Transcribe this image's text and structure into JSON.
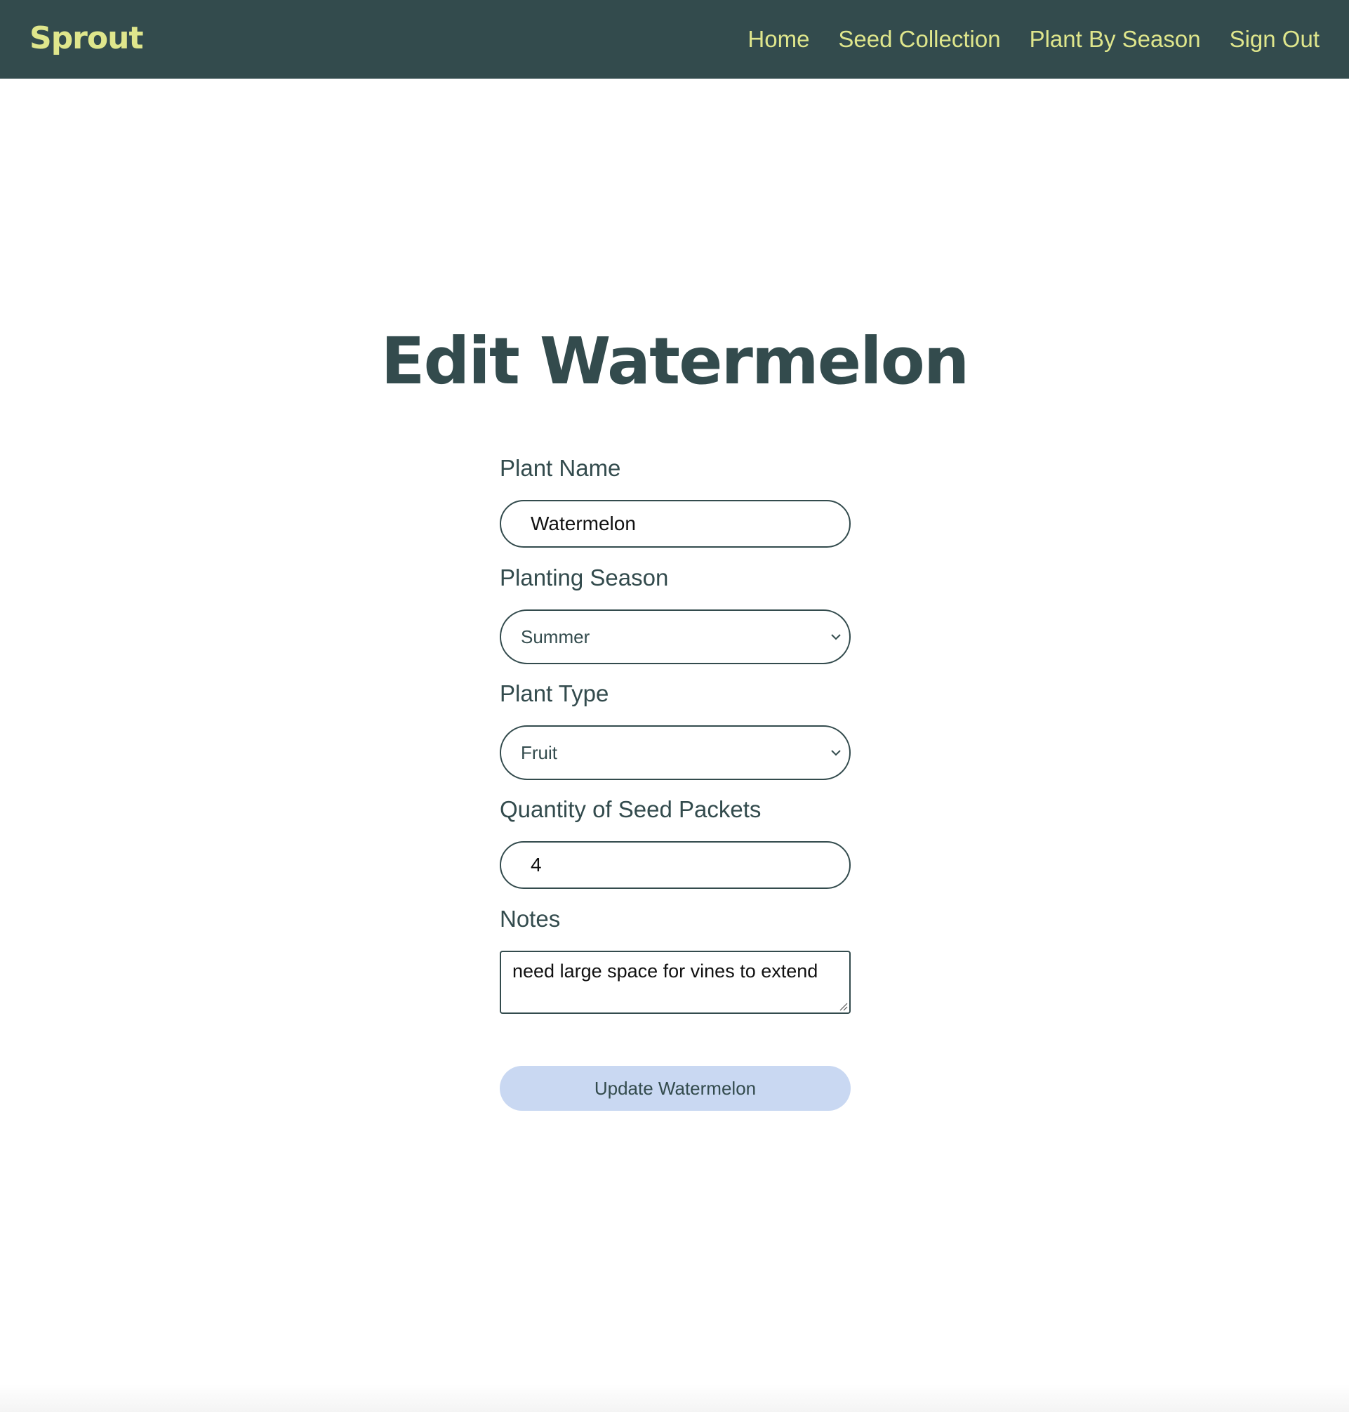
{
  "navbar": {
    "brand": "Sprout",
    "links": [
      {
        "label": "Home"
      },
      {
        "label": "Seed Collection"
      },
      {
        "label": "Plant By Season"
      },
      {
        "label": "Sign Out"
      }
    ]
  },
  "page": {
    "title": "Edit Watermelon"
  },
  "form": {
    "plant_name": {
      "label": "Plant Name",
      "value": "Watermelon"
    },
    "planting_season": {
      "label": "Planting Season",
      "selected": "Summer"
    },
    "plant_type": {
      "label": "Plant Type",
      "selected": "Fruit"
    },
    "quantity": {
      "label": "Quantity of Seed Packets",
      "value": "4"
    },
    "notes": {
      "label": "Notes",
      "value": "need large space for vines to extend"
    },
    "submit_label": "Update Watermelon"
  },
  "colors": {
    "nav_background": "#334b4d",
    "nav_text": "#dfe68c",
    "heading": "#334b4d",
    "button_background": "#c9d8f2"
  },
  "icons": {
    "select_arrow": "chevron-down-icon",
    "textarea_resize": "resize-handle-icon"
  }
}
